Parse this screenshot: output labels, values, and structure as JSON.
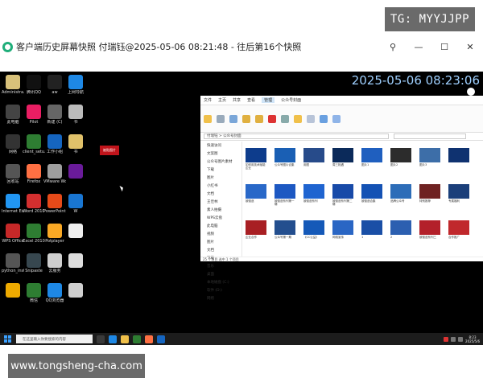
{
  "watermarks": {
    "top_right": "TG: MYYJJPP",
    "bottom_left": "www.tongsheng-cha.com"
  },
  "window": {
    "title": "客户端历史屏幕快照 付瑞钰@2025-05-06 08:21:48 - 往后第16个快照",
    "controls": {
      "pin": "⚲",
      "minimize": "—",
      "maximize": "☐",
      "close": "✕"
    }
  },
  "screen": {
    "clock": "2025-05-06 08:23:06",
    "desktop_icons": [
      {
        "label": "Administra...",
        "color": "#d8c17a"
      },
      {
        "label": "腾讯QQ",
        "color": "#111111"
      },
      {
        "label": "aw",
        "color": "#222222"
      },
      {
        "label": "上网导航",
        "color": "#1e88e5"
      },
      {
        "label": "此电脑",
        "color": "#444444"
      },
      {
        "label": "Pilot",
        "color": "#e91e63"
      },
      {
        "label": "新建 (C)",
        "color": "#666666"
      },
      {
        "label": "书",
        "color": "#bbbbbb"
      },
      {
        "label": "网络",
        "color": "#333333"
      },
      {
        "label": "client_setu...",
        "color": "#2e7d32"
      },
      {
        "label": "工作小组",
        "color": "#1565c0"
      },
      {
        "label": "书",
        "color": "#e0c16a"
      },
      {
        "label": "回收站",
        "color": "#555555"
      },
      {
        "label": "Firefox",
        "color": "#ff7043"
      },
      {
        "label": "VMware Worksta...",
        "color": "#9e9e9e"
      },
      {
        "label": "",
        "color": "#6a1b9a"
      },
      {
        "label": "Internet Explorer",
        "color": "#2196f3"
      },
      {
        "label": "Word 2010",
        "color": "#d32f2f"
      },
      {
        "label": "PowerPoint...",
        "color": "#e64a19"
      },
      {
        "label": "W",
        "color": "#1976d2"
      },
      {
        "label": "WPS Office",
        "color": "#c62828"
      },
      {
        "label": "Excel 2010",
        "color": "#2e7d32"
      },
      {
        "label": "Potplayer",
        "color": "#f9a825"
      },
      {
        "label": "",
        "color": "#eeeeee"
      },
      {
        "label": "python_inst...",
        "color": "#555555"
      },
      {
        "label": "Snipaste",
        "color": "#37474f"
      },
      {
        "label": "云服务",
        "color": "#cfcfcf"
      },
      {
        "label": "",
        "color": "#dddddd"
      },
      {
        "label": "",
        "color": "#eeaa00"
      },
      {
        "label": "微信",
        "color": "#2e7d32"
      },
      {
        "label": "QQ浏览器",
        "color": "#1e88e5"
      },
      {
        "label": "",
        "color": "#cfcfcf"
      }
    ],
    "red_tag": "被贴图片",
    "explorer": {
      "tabs": [
        "文件",
        "主页",
        "共享",
        "查看",
        "管理",
        "公众号封面"
      ],
      "address": "付瑞钰 > 公众号封面",
      "nav_items": [
        "快速访问",
        "文案图",
        "公众号图片素材",
        "下载",
        "图片",
        "小红书",
        "文档",
        "王佳林",
        "素人拍摄",
        "WPS云盘",
        "此电脑",
        "视频",
        "图片",
        "文档",
        "下载",
        "音乐",
        "桌面",
        "本地磁盘 (C:)",
        "软件 (D:)",
        "网络"
      ],
      "thumbs": [
        {
          "caption": "如何用技术赋能企业",
          "color": "#0d3c8c"
        },
        {
          "caption": "公众号图片合集",
          "color": "#1a5fb4"
        },
        {
          "caption": "用图",
          "color": "#274b8a"
        },
        {
          "caption": "周三相遇",
          "color": "#0b2a5a"
        },
        {
          "caption": "图片1",
          "color": "#1f5fbf"
        },
        {
          "caption": "图片2",
          "color": "#2c2c2c"
        },
        {
          "caption": "图片3",
          "color": "#3d6ea8"
        },
        {
          "caption": "",
          "color": "#0f3270"
        },
        {
          "caption": "被驱逐",
          "color": "#2968c8"
        },
        {
          "caption": "被驱逐系列第一辑",
          "color": "#1d58c2"
        },
        {
          "caption": "被驱逐系列",
          "color": "#1f64d0"
        },
        {
          "caption": "被驱逐系列第二辑",
          "color": "#184aa8"
        },
        {
          "caption": "被驱逐合集",
          "color": "#1452b4"
        },
        {
          "caption": "品牌公众号",
          "color": "#2d6db8"
        },
        {
          "caption": "特别推荐",
          "color": "#6f2222"
        },
        {
          "caption": "专属福利",
          "color": "#1b3f7a"
        },
        {
          "caption": "企业合作",
          "color": "#a81f23"
        },
        {
          "caption": "公众号第一期",
          "color": "#234e8e"
        },
        {
          "caption": "《CC公益》",
          "color": "#1559b8"
        },
        {
          "caption": "网络宣传",
          "color": "#2a66c4"
        },
        {
          "caption": "1",
          "color": "#1a4fa6"
        },
        {
          "caption": "2",
          "color": "#2c5fb0"
        },
        {
          "caption": "被驱逐系列三",
          "color": "#b3202a"
        },
        {
          "caption": "合作推广",
          "color": "#c0282c"
        }
      ],
      "status": "25 个项目 选中 1 个项目"
    },
    "taskbar": {
      "search_placeholder": "在这里输入你要搜索的内容",
      "time": "8:23",
      "date": "2025/5/6"
    }
  }
}
